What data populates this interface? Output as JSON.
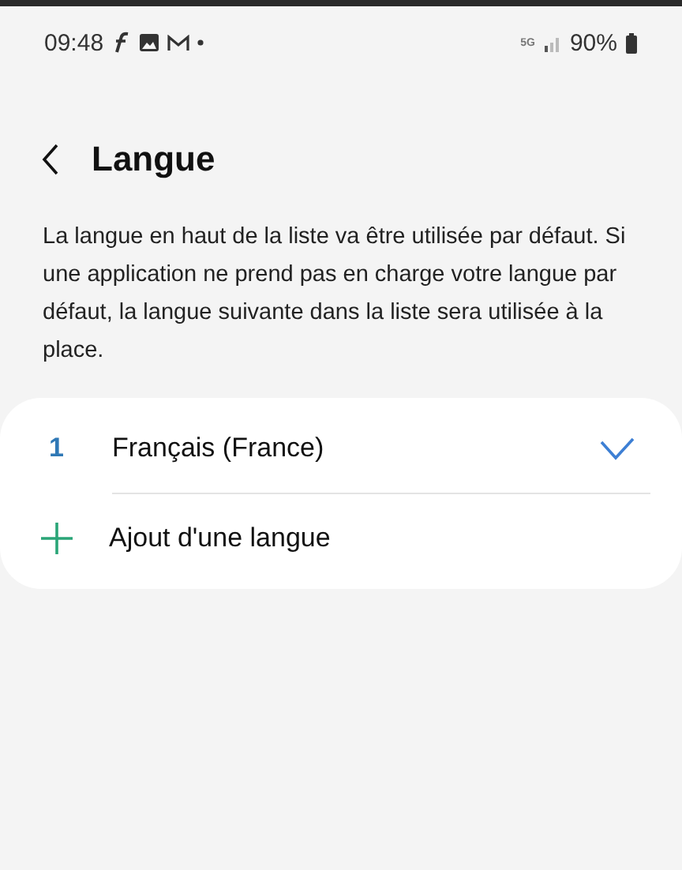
{
  "status_bar": {
    "time": "09:48",
    "network": "5G",
    "battery": "90%"
  },
  "header": {
    "title": "Langue"
  },
  "description": "La langue en haut de la liste va être utilisée par défaut. Si une application ne prend pas en charge votre langue par défaut, la langue suivante dans la liste sera utilisée à la place.",
  "languages": [
    {
      "index": "1",
      "name": "Français (France)",
      "selected": true
    }
  ],
  "add_language": {
    "label": "Ajout d'une langue"
  }
}
